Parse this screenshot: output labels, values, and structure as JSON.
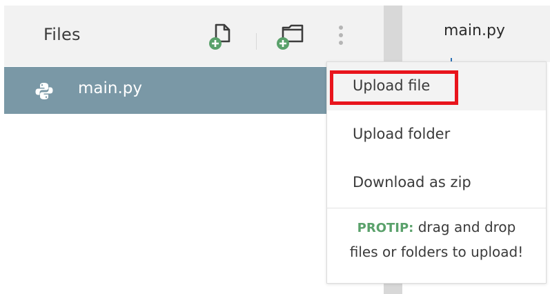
{
  "files_panel": {
    "title": "Files",
    "files": [
      {
        "name": "main.py",
        "icon": "python-icon",
        "selected": true
      }
    ]
  },
  "editor": {
    "tabs": [
      {
        "label": "main.py",
        "active": true
      }
    ]
  },
  "dropdown_menu": {
    "items": [
      {
        "label": "Upload file",
        "highlighted": true
      },
      {
        "label": "Upload folder"
      },
      {
        "label": "Download as zip"
      }
    ],
    "protip": {
      "label": "PROTIP:",
      "line1": "drag and drop",
      "line2": "files or folders to upload!"
    }
  },
  "colors": {
    "header_bg": "#f2f2f2",
    "selected_row_bg": "#7a98a6",
    "accent_green": "#5aa16b",
    "highlight_red": "#e8141c"
  },
  "icons": {
    "new_file": "new-file-icon",
    "new_folder": "new-folder-icon",
    "more": "more-vertical-icon",
    "file": "python-icon"
  }
}
